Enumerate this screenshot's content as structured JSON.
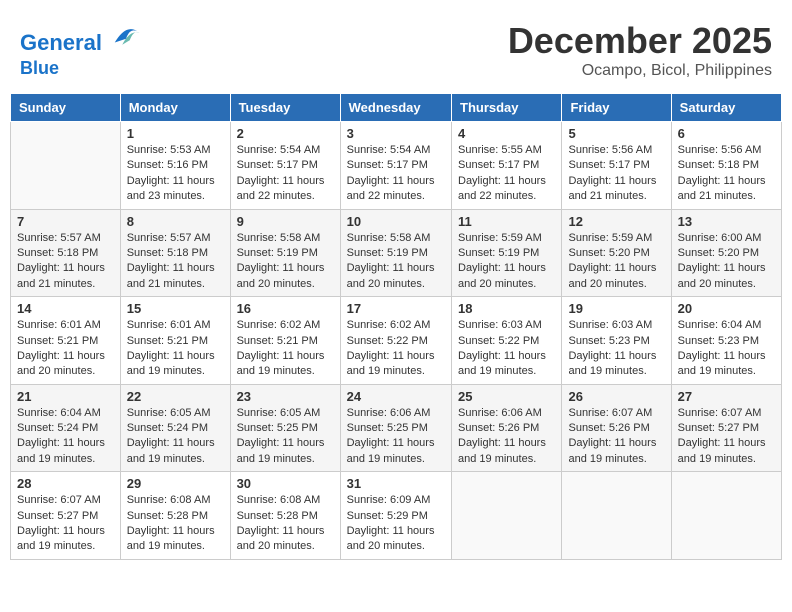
{
  "header": {
    "logo_line1": "General",
    "logo_line2": "Blue",
    "month": "December 2025",
    "location": "Ocampo, Bicol, Philippines"
  },
  "days_of_week": [
    "Sunday",
    "Monday",
    "Tuesday",
    "Wednesday",
    "Thursday",
    "Friday",
    "Saturday"
  ],
  "weeks": [
    [
      {
        "day": "",
        "empty": true
      },
      {
        "day": "1",
        "sunrise": "5:53 AM",
        "sunset": "5:16 PM",
        "daylight": "11 hours and 23 minutes."
      },
      {
        "day": "2",
        "sunrise": "5:54 AM",
        "sunset": "5:17 PM",
        "daylight": "11 hours and 22 minutes."
      },
      {
        "day": "3",
        "sunrise": "5:54 AM",
        "sunset": "5:17 PM",
        "daylight": "11 hours and 22 minutes."
      },
      {
        "day": "4",
        "sunrise": "5:55 AM",
        "sunset": "5:17 PM",
        "daylight": "11 hours and 22 minutes."
      },
      {
        "day": "5",
        "sunrise": "5:56 AM",
        "sunset": "5:17 PM",
        "daylight": "11 hours and 21 minutes."
      },
      {
        "day": "6",
        "sunrise": "5:56 AM",
        "sunset": "5:18 PM",
        "daylight": "11 hours and 21 minutes."
      }
    ],
    [
      {
        "day": "7",
        "sunrise": "5:57 AM",
        "sunset": "5:18 PM",
        "daylight": "11 hours and 21 minutes."
      },
      {
        "day": "8",
        "sunrise": "5:57 AM",
        "sunset": "5:18 PM",
        "daylight": "11 hours and 21 minutes."
      },
      {
        "day": "9",
        "sunrise": "5:58 AM",
        "sunset": "5:19 PM",
        "daylight": "11 hours and 20 minutes."
      },
      {
        "day": "10",
        "sunrise": "5:58 AM",
        "sunset": "5:19 PM",
        "daylight": "11 hours and 20 minutes."
      },
      {
        "day": "11",
        "sunrise": "5:59 AM",
        "sunset": "5:19 PM",
        "daylight": "11 hours and 20 minutes."
      },
      {
        "day": "12",
        "sunrise": "5:59 AM",
        "sunset": "5:20 PM",
        "daylight": "11 hours and 20 minutes."
      },
      {
        "day": "13",
        "sunrise": "6:00 AM",
        "sunset": "5:20 PM",
        "daylight": "11 hours and 20 minutes."
      }
    ],
    [
      {
        "day": "14",
        "sunrise": "6:01 AM",
        "sunset": "5:21 PM",
        "daylight": "11 hours and 20 minutes."
      },
      {
        "day": "15",
        "sunrise": "6:01 AM",
        "sunset": "5:21 PM",
        "daylight": "11 hours and 19 minutes."
      },
      {
        "day": "16",
        "sunrise": "6:02 AM",
        "sunset": "5:21 PM",
        "daylight": "11 hours and 19 minutes."
      },
      {
        "day": "17",
        "sunrise": "6:02 AM",
        "sunset": "5:22 PM",
        "daylight": "11 hours and 19 minutes."
      },
      {
        "day": "18",
        "sunrise": "6:03 AM",
        "sunset": "5:22 PM",
        "daylight": "11 hours and 19 minutes."
      },
      {
        "day": "19",
        "sunrise": "6:03 AM",
        "sunset": "5:23 PM",
        "daylight": "11 hours and 19 minutes."
      },
      {
        "day": "20",
        "sunrise": "6:04 AM",
        "sunset": "5:23 PM",
        "daylight": "11 hours and 19 minutes."
      }
    ],
    [
      {
        "day": "21",
        "sunrise": "6:04 AM",
        "sunset": "5:24 PM",
        "daylight": "11 hours and 19 minutes."
      },
      {
        "day": "22",
        "sunrise": "6:05 AM",
        "sunset": "5:24 PM",
        "daylight": "11 hours and 19 minutes."
      },
      {
        "day": "23",
        "sunrise": "6:05 AM",
        "sunset": "5:25 PM",
        "daylight": "11 hours and 19 minutes."
      },
      {
        "day": "24",
        "sunrise": "6:06 AM",
        "sunset": "5:25 PM",
        "daylight": "11 hours and 19 minutes."
      },
      {
        "day": "25",
        "sunrise": "6:06 AM",
        "sunset": "5:26 PM",
        "daylight": "11 hours and 19 minutes."
      },
      {
        "day": "26",
        "sunrise": "6:07 AM",
        "sunset": "5:26 PM",
        "daylight": "11 hours and 19 minutes."
      },
      {
        "day": "27",
        "sunrise": "6:07 AM",
        "sunset": "5:27 PM",
        "daylight": "11 hours and 19 minutes."
      }
    ],
    [
      {
        "day": "28",
        "sunrise": "6:07 AM",
        "sunset": "5:27 PM",
        "daylight": "11 hours and 19 minutes."
      },
      {
        "day": "29",
        "sunrise": "6:08 AM",
        "sunset": "5:28 PM",
        "daylight": "11 hours and 19 minutes."
      },
      {
        "day": "30",
        "sunrise": "6:08 AM",
        "sunset": "5:28 PM",
        "daylight": "11 hours and 20 minutes."
      },
      {
        "day": "31",
        "sunrise": "6:09 AM",
        "sunset": "5:29 PM",
        "daylight": "11 hours and 20 minutes."
      },
      {
        "day": "",
        "empty": true
      },
      {
        "day": "",
        "empty": true
      },
      {
        "day": "",
        "empty": true
      }
    ]
  ]
}
